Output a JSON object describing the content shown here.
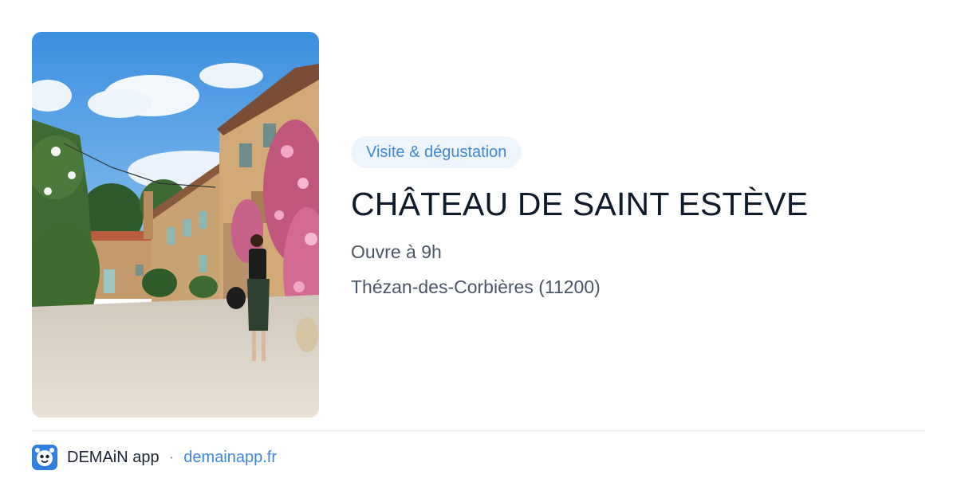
{
  "photo": {
    "subject": "Stone château courtyard with flowering bushes and a woman walking"
  },
  "card": {
    "category": "Visite & dégustation",
    "title": "CHÂTEAU DE SAINT ESTÈVE",
    "hours": "Ouvre à 9h",
    "location": "Thézan-des-Corbières (11200)"
  },
  "footer": {
    "app_name": "DEMAiN app",
    "separator": "·",
    "url": "demainapp.fr"
  },
  "colors": {
    "accent": "#3f86d8",
    "badge_bg": "#eef5fd",
    "title": "#0f1a2a",
    "meta": "#4a5565"
  },
  "icons": {
    "app_logo": "demain-app-icon"
  }
}
